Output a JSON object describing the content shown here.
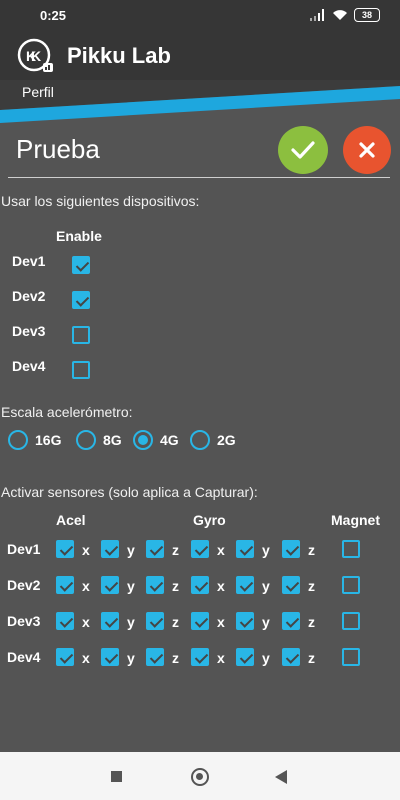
{
  "status": {
    "time": "0:25",
    "battery": "38"
  },
  "app": {
    "title": "Pikku Lab"
  },
  "subbar": {
    "label": "Perfil"
  },
  "profile": {
    "name": "Prueba"
  },
  "devices": {
    "heading": "Usar los siguientes dispositivos:",
    "enable_header": "Enable",
    "rows": [
      {
        "label": "Dev1",
        "enabled": true
      },
      {
        "label": "Dev2",
        "enabled": true
      },
      {
        "label": "Dev3",
        "enabled": false
      },
      {
        "label": "Dev4",
        "enabled": false
      }
    ]
  },
  "scale": {
    "heading": "Escala acelerómetro:",
    "options": [
      "16G",
      "8G",
      "4G",
      "2G"
    ],
    "selected": "4G"
  },
  "sensors": {
    "heading": "Activar sensores (solo aplica a Capturar):",
    "col_acel": "Acel",
    "col_gyro": "Gyro",
    "col_magnet": "Magnet",
    "axes": [
      "x",
      "y",
      "z"
    ],
    "rows": [
      {
        "label": "Dev1",
        "acel": [
          true,
          true,
          true
        ],
        "gyro": [
          true,
          true,
          true
        ],
        "magnet": false
      },
      {
        "label": "Dev2",
        "acel": [
          true,
          true,
          true
        ],
        "gyro": [
          true,
          true,
          true
        ],
        "magnet": false
      },
      {
        "label": "Dev3",
        "acel": [
          true,
          true,
          true
        ],
        "gyro": [
          true,
          true,
          true
        ],
        "magnet": false
      },
      {
        "label": "Dev4",
        "acel": [
          true,
          true,
          true
        ],
        "gyro": [
          true,
          true,
          true
        ],
        "magnet": false
      }
    ]
  },
  "colors": {
    "accent": "#29b6e6",
    "ok": "#8cbf3f",
    "cancel": "#e8542f",
    "background": "#545454"
  }
}
